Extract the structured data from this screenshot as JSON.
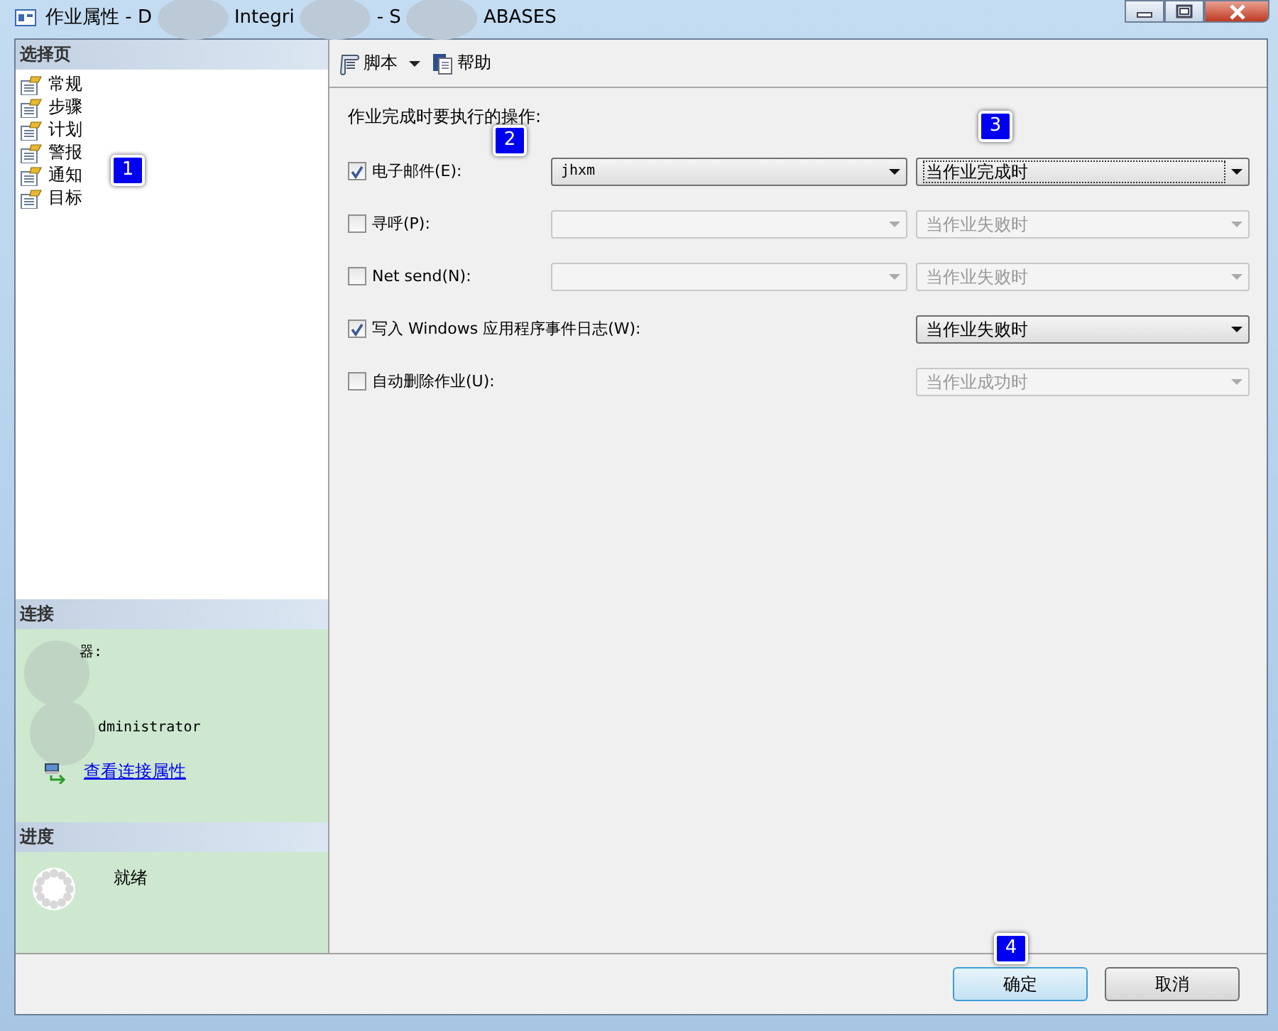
{
  "window": {
    "title_parts": [
      "作业属性 - D",
      "Integri",
      "- S",
      "ABASES"
    ]
  },
  "sidebar": {
    "header": "选择页",
    "items": [
      {
        "label": "常规"
      },
      {
        "label": "步骤"
      },
      {
        "label": "计划"
      },
      {
        "label": "警报"
      },
      {
        "label": "通知",
        "badge": "1"
      },
      {
        "label": "目标"
      }
    ],
    "connection": {
      "header": "连接",
      "server_label": "器:",
      "user": "dministrator",
      "link": "查看连接属性"
    },
    "progress": {
      "header": "进度",
      "status": "就绪"
    }
  },
  "toolbar": {
    "script": "脚本",
    "help": "帮助"
  },
  "options": {
    "heading": "作业完成时要执行的操作:",
    "rows": [
      {
        "label": "电子邮件(E):",
        "checked": true,
        "badge": "2",
        "operator": {
          "value": "jhxm",
          "enabled": true
        },
        "when": {
          "value": "当作业完成时",
          "enabled": true,
          "focused": true,
          "badge": "3"
        }
      },
      {
        "label": "寻呼(P):",
        "checked": false,
        "operator": {
          "enabled": false
        },
        "when": {
          "value": "当作业失败时",
          "enabled": false,
          "focused": false
        }
      },
      {
        "label": "Net send(N):",
        "checked": false,
        "operator": {
          "enabled": false
        },
        "when": {
          "value": "当作业失败时",
          "enabled": false,
          "focused": false
        }
      },
      {
        "label": "写入 Windows 应用程序事件日志(W):",
        "checked": true,
        "when": {
          "value": "当作业失败时",
          "enabled": true,
          "focused": false
        }
      },
      {
        "label": "自动删除作业(U):",
        "checked": false,
        "when": {
          "value": "当作业成功时",
          "enabled": false,
          "focused": false
        }
      }
    ]
  },
  "buttons": [
    {
      "label": "确定",
      "default": true,
      "badge": "4"
    },
    {
      "label": "取消",
      "default": false
    }
  ]
}
